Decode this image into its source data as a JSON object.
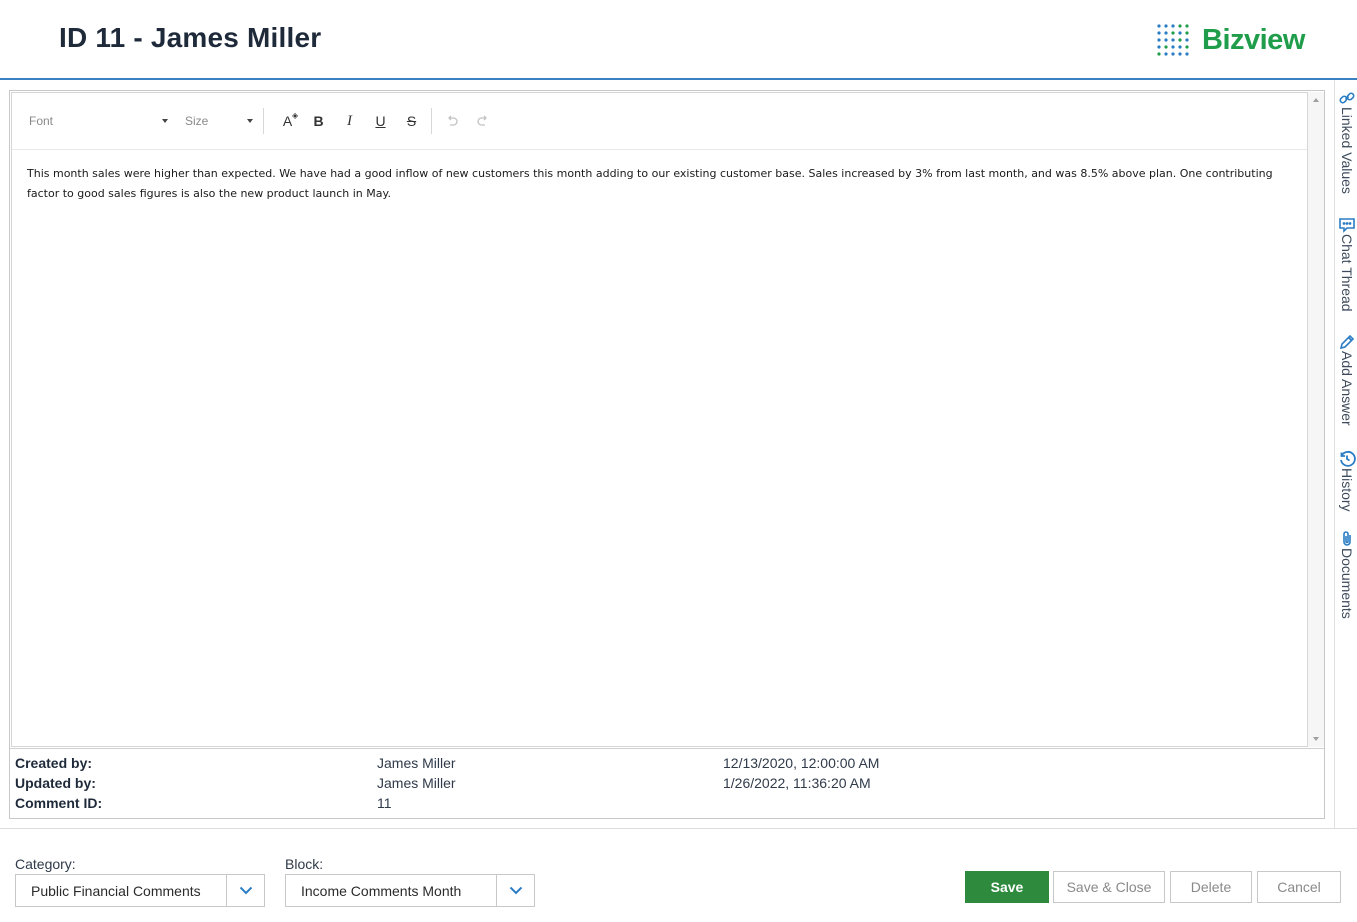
{
  "header": {
    "title": "ID 11 - James Miller",
    "logo_text": "Bizview",
    "logo_color": "#1f9d4a"
  },
  "editor": {
    "toolbar": {
      "font_placeholder": "Font",
      "size_placeholder": "Size",
      "buttons": [
        "font-color",
        "bold",
        "italic",
        "underline",
        "strikethrough",
        "undo",
        "redo"
      ],
      "bold_label": "B",
      "italic_label": "I",
      "underline_label": "U",
      "strike_label": "S",
      "fontcolor_label": "A"
    },
    "content": "This month sales were higher than expected. We have had a good inflow of new customers this month adding to our existing customer base. Sales increased by 3% from last month, and was 8.5% above plan. One contributing factor to good sales figures is also the new product launch in May."
  },
  "meta": {
    "created": {
      "label": "Created by:",
      "name": "James Miller",
      "date": "12/13/2020, 12:00:00 AM"
    },
    "updated": {
      "label": "Updated by:",
      "name": "James Miller",
      "date": "1/26/2022, 11:36:20 AM"
    },
    "comment_id": {
      "label": "Comment ID:",
      "value": "11"
    }
  },
  "side_panel": {
    "items": [
      {
        "label": "Linked Values",
        "icon": "link-icon"
      },
      {
        "label": "Chat Thread",
        "icon": "chat-icon"
      },
      {
        "label": "Add Answer",
        "icon": "pencil-icon"
      },
      {
        "label": "History",
        "icon": "history-icon"
      },
      {
        "label": "Documents",
        "icon": "paperclip-icon"
      }
    ],
    "accent": "#2a7dc4"
  },
  "footer": {
    "category_label": "Category:",
    "category_value": "Public Financial Comments",
    "block_label": "Block:",
    "block_value": "Income Comments Month",
    "save": "Save",
    "save_close": "Save & Close",
    "delete": "Delete",
    "cancel": "Cancel",
    "save_color": "#2e8b3e"
  }
}
